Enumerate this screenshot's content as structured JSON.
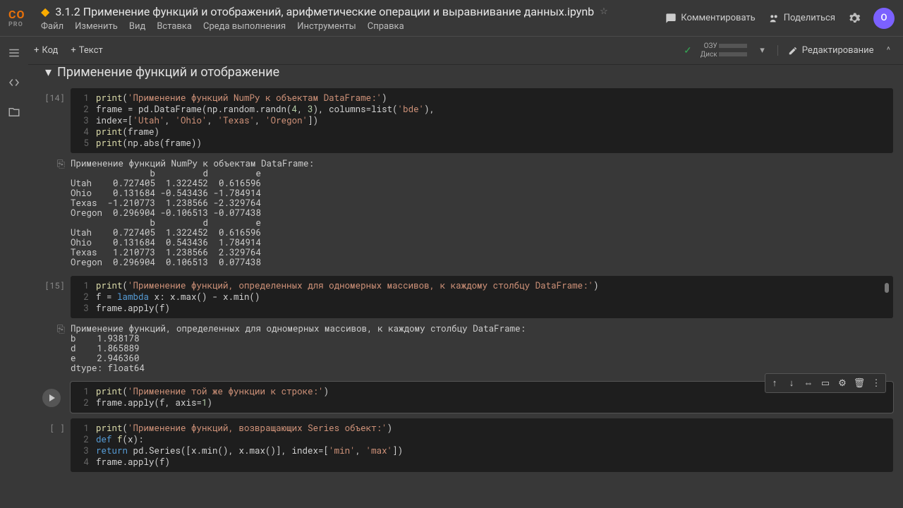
{
  "header": {
    "logo_top": "CO",
    "logo_bot": "PRO",
    "title": "3.1.2 Применение функций и отображений, арифметические операции и выравнивание данных.ipynb",
    "menu": [
      "Файл",
      "Изменить",
      "Вид",
      "Вставка",
      "Среда выполнения",
      "Инструменты",
      "Справка"
    ],
    "comment": "Комментировать",
    "share": "Поделиться",
    "avatar": "O"
  },
  "toolbar": {
    "code": "Код",
    "text": "Текст",
    "ram": "ОЗУ",
    "disk": "Диск",
    "edit": "Редактирование"
  },
  "section": "Применение функций и отображение",
  "cells": [
    {
      "exec": "[14]",
      "lines": [
        [
          {
            "t": "print",
            "c": "fn"
          },
          {
            "t": "("
          },
          {
            "t": "'Применение функций NumPy к объектам DataFrame:'",
            "c": "str"
          },
          {
            "t": ")"
          }
        ],
        [
          {
            "t": "frame = pd.DataFrame(np.random.randn("
          },
          {
            "t": "4",
            "c": "num"
          },
          {
            "t": ", "
          },
          {
            "t": "3",
            "c": "num"
          },
          {
            "t": "), columns=list("
          },
          {
            "t": "'bde'",
            "c": "str"
          },
          {
            "t": "),"
          }
        ],
        [
          {
            "t": "                   index=["
          },
          {
            "t": "'Utah'",
            "c": "str"
          },
          {
            "t": ", "
          },
          {
            "t": "'Ohio'",
            "c": "str"
          },
          {
            "t": ", "
          },
          {
            "t": "'Texas'",
            "c": "str"
          },
          {
            "t": ", "
          },
          {
            "t": "'Oregon'",
            "c": "str"
          },
          {
            "t": "])"
          }
        ],
        [
          {
            "t": "print",
            "c": "fn"
          },
          {
            "t": "(frame)"
          }
        ],
        [
          {
            "t": "print",
            "c": "fn"
          },
          {
            "t": "(np.abs(frame))"
          }
        ]
      ],
      "output": "Применение функций NumPy к объектам DataFrame:\n               b         d         e\nUtah    0.727405  1.322452  0.616596\nOhio    0.131684 -0.543436 -1.784914\nTexas  -1.210773  1.238566 -2.329764\nOregon  0.296904 -0.106513 -0.077438\n               b         d         e\nUtah    0.727405  1.322452  0.616596\nOhio    0.131684  0.543436  1.784914\nTexas   1.210773  1.238566  2.329764\nOregon  0.296904  0.106513  0.077438"
    },
    {
      "exec": "[15]",
      "lines": [
        [
          {
            "t": "print",
            "c": "fn"
          },
          {
            "t": "("
          },
          {
            "t": "'Применение функций, определенных для одномерных массивов, к каждому столбцу DataFrame:'",
            "c": "str"
          },
          {
            "t": ")"
          }
        ],
        [
          {
            "t": "f = "
          },
          {
            "t": "lambda",
            "c": "kw"
          },
          {
            "t": " x: x.max() - x.min()"
          }
        ],
        [
          {
            "t": "frame.apply(f)"
          }
        ]
      ],
      "output": "Применение функций, определенных для одномерных массивов, к каждому столбцу DataFrame:\nb    1.938178\nd    1.865889\ne    2.946360\ndtype: float64",
      "scrollthumb": true
    },
    {
      "exec": "run",
      "active": true,
      "actions": true,
      "lines": [
        [
          {
            "t": "print",
            "c": "fn"
          },
          {
            "t": "("
          },
          {
            "t": "'Применение той же функции к строке:'",
            "c": "str"
          },
          {
            "t": ")"
          }
        ],
        [
          {
            "t": "frame.apply(f, axis="
          },
          {
            "t": "1",
            "c": "num"
          },
          {
            "t": ")"
          }
        ]
      ]
    },
    {
      "exec": "[ ]",
      "lines": [
        [
          {
            "t": "print",
            "c": "fn"
          },
          {
            "t": "("
          },
          {
            "t": "'Применение функций, возвращающих Series объект:'",
            "c": "str"
          },
          {
            "t": ")"
          }
        ],
        [
          {
            "t": "def ",
            "c": "kw"
          },
          {
            "t": "f",
            "c": "fn"
          },
          {
            "t": "(x):"
          }
        ],
        [
          {
            "t": "    "
          },
          {
            "t": "return",
            "c": "kw"
          },
          {
            "t": " pd.Series([x.min(), x.max()], index=["
          },
          {
            "t": "'min'",
            "c": "str"
          },
          {
            "t": ", "
          },
          {
            "t": "'max'",
            "c": "str"
          },
          {
            "t": "])"
          }
        ],
        [
          {
            "t": "frame.apply(f)"
          }
        ]
      ]
    }
  ]
}
